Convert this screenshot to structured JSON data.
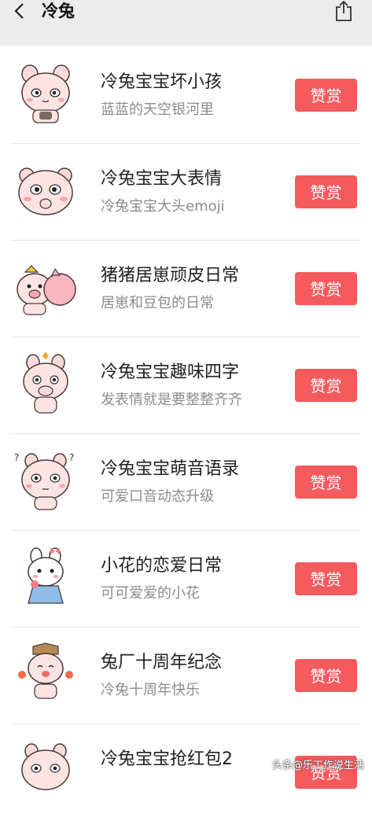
{
  "header": {
    "title": "冷兔"
  },
  "action_label": "赞赏",
  "items": [
    {
      "name": "冷兔宝宝坏小孩",
      "desc": "蓝蓝的天空银河里"
    },
    {
      "name": "冷兔宝宝大表情",
      "desc": "冷兔宝宝大头emoji"
    },
    {
      "name": "猪猪居崽顽皮日常",
      "desc": "居崽和豆包的日常"
    },
    {
      "name": "冷兔宝宝趣味四字",
      "desc": "发表情就是要整整齐齐"
    },
    {
      "name": "冷兔宝宝萌音语录",
      "desc": "可爱口音动态升级"
    },
    {
      "name": "小花的恋爱日常",
      "desc": "可可爱爱的小花"
    },
    {
      "name": "兔厂十周年纪念",
      "desc": "冷兔十周年快乐"
    },
    {
      "name": "冷兔宝宝抢红包2",
      "desc": ""
    }
  ],
  "watermark": "头条@乐工作说生活",
  "colors": {
    "accent": "#f55a5d",
    "header_bg": "#ececec"
  },
  "icons": {
    "back": "chevron-left-icon",
    "share": "share-icon"
  }
}
